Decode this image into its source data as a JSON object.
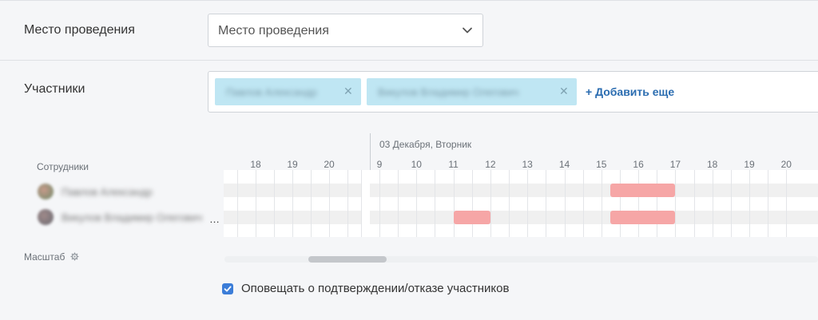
{
  "venue": {
    "label": "Место проведения",
    "select_value": "Место проведения"
  },
  "participants": {
    "label": "Участники",
    "tags": [
      {
        "name": "Павлов Александр"
      },
      {
        "name": "Викулов Владимир Олегович"
      }
    ],
    "add_more": "+ Добавить еще"
  },
  "schedule": {
    "date_label": "03 Декабря, Вторник",
    "employees_label": "Сотрудники",
    "hours_before": [
      "18",
      "19",
      "20"
    ],
    "hours_after": [
      "9",
      "10",
      "11",
      "12",
      "13",
      "14",
      "15",
      "16",
      "17",
      "18",
      "19",
      "20"
    ],
    "people": [
      {
        "name": "Павлов Александр"
      },
      {
        "name": "Викулов Владимир Олегович"
      }
    ],
    "truncation": "…",
    "scale_label": "Масштаб",
    "busy": [
      {
        "person": 0,
        "start": "15:15",
        "end": "17:00"
      },
      {
        "person": 1,
        "start": "11:00",
        "end": "12:00"
      },
      {
        "person": 1,
        "start": "15:15",
        "end": "17:00"
      }
    ]
  },
  "notify": {
    "label": "Оповещать о подтверждении/отказе участников",
    "checked": true
  },
  "colors": {
    "tag_bg": "#bfe6f3",
    "busy": "#f6a6a6",
    "link": "#2a6cb0",
    "checkbox": "#3b7dd8"
  }
}
